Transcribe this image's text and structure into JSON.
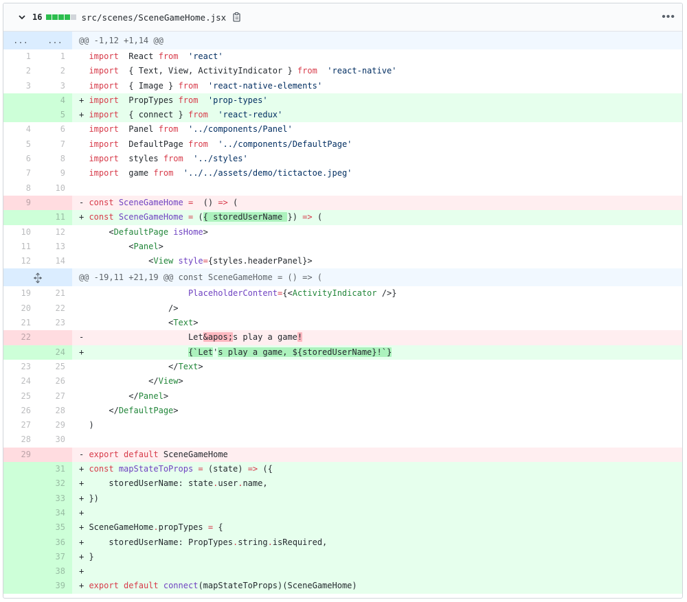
{
  "file": {
    "change_count": "16",
    "path": "src/scenes/SceneGameHome.jsx",
    "more_label": "•••",
    "diffstat_colors": [
      "#2cbe4e",
      "#2cbe4e",
      "#2cbe4e",
      "#2cbe4e",
      "#d1d5da"
    ]
  },
  "colors": {
    "add_line_bg": "#e6ffed",
    "add_num_bg": "#cdffd8",
    "del_line_bg": "#ffeef0",
    "del_num_bg": "#ffdce0",
    "hunk_bg": "#f1f8ff",
    "keyword": "#d73a49",
    "string": "#032f62",
    "function": "#6f42c1",
    "tag": "#22863a"
  },
  "hunks": [
    {
      "left": "...",
      "right": "...",
      "header": "@@ -1,12 +1,14 @@"
    },
    {
      "left_icon": "unfold-icon",
      "header": "@@ -19,11 +21,19 @@ const SceneGameHome = () => ("
    }
  ],
  "lines": [
    {
      "type": "ctx",
      "old": "1",
      "new": "1",
      "sign": " ",
      "tokens": [
        [
          "k",
          "import"
        ],
        [
          "",
          "  React "
        ],
        [
          "k",
          "from"
        ],
        [
          "",
          "  "
        ],
        [
          "s",
          "'react'"
        ]
      ]
    },
    {
      "type": "ctx",
      "old": "2",
      "new": "2",
      "sign": " ",
      "tokens": [
        [
          "k",
          "import"
        ],
        [
          "",
          "  { Text, View, ActivityIndicator } "
        ],
        [
          "k",
          "from"
        ],
        [
          "",
          "  "
        ],
        [
          "s",
          "'react-native'"
        ]
      ]
    },
    {
      "type": "ctx",
      "old": "3",
      "new": "3",
      "sign": " ",
      "tokens": [
        [
          "k",
          "import"
        ],
        [
          "",
          "  { Image } "
        ],
        [
          "k",
          "from"
        ],
        [
          "",
          "  "
        ],
        [
          "s",
          "'react-native-elements'"
        ]
      ]
    },
    {
      "type": "add",
      "old": "",
      "new": "4",
      "sign": "+",
      "tokens": [
        [
          "k",
          "import"
        ],
        [
          "",
          "  PropTypes "
        ],
        [
          "k",
          "from"
        ],
        [
          "",
          "  "
        ],
        [
          "s",
          "'prop-types'"
        ]
      ]
    },
    {
      "type": "add",
      "old": "",
      "new": "5",
      "sign": "+",
      "tokens": [
        [
          "k",
          "import"
        ],
        [
          "",
          "  { connect } "
        ],
        [
          "k",
          "from"
        ],
        [
          "",
          "  "
        ],
        [
          "s",
          "'react-redux'"
        ]
      ]
    },
    {
      "type": "ctx",
      "old": "4",
      "new": "6",
      "sign": " ",
      "tokens": [
        [
          "k",
          "import"
        ],
        [
          "",
          "  Panel "
        ],
        [
          "k",
          "from"
        ],
        [
          "",
          "  "
        ],
        [
          "s",
          "'../components/Panel'"
        ]
      ]
    },
    {
      "type": "ctx",
      "old": "5",
      "new": "7",
      "sign": " ",
      "tokens": [
        [
          "k",
          "import"
        ],
        [
          "",
          "  DefaultPage "
        ],
        [
          "k",
          "from"
        ],
        [
          "",
          "  "
        ],
        [
          "s",
          "'../components/DefaultPage'"
        ]
      ]
    },
    {
      "type": "ctx",
      "old": "6",
      "new": "8",
      "sign": " ",
      "tokens": [
        [
          "k",
          "import"
        ],
        [
          "",
          "  styles "
        ],
        [
          "k",
          "from"
        ],
        [
          "",
          "  "
        ],
        [
          "s",
          "'../styles'"
        ]
      ]
    },
    {
      "type": "ctx",
      "old": "7",
      "new": "9",
      "sign": " ",
      "tokens": [
        [
          "k",
          "import"
        ],
        [
          "",
          "  game "
        ],
        [
          "k",
          "from"
        ],
        [
          "",
          "  "
        ],
        [
          "s",
          "'../../assets/demo/tictactoe.jpeg'"
        ]
      ]
    },
    {
      "type": "ctx",
      "old": "8",
      "new": "10",
      "sign": " ",
      "tokens": []
    },
    {
      "type": "del",
      "old": "9",
      "new": "",
      "sign": "-",
      "tokens": [
        [
          "k",
          "const"
        ],
        [
          "",
          " "
        ],
        [
          "f",
          "SceneGameHome"
        ],
        [
          "",
          " "
        ],
        [
          "k",
          "="
        ],
        [
          "",
          "  () "
        ],
        [
          "k",
          "=>"
        ],
        [
          "",
          " ("
        ]
      ]
    },
    {
      "type": "add",
      "old": "",
      "new": "11",
      "sign": "+",
      "tokens": [
        [
          "k",
          "const"
        ],
        [
          "",
          " "
        ],
        [
          "f",
          "SceneGameHome"
        ],
        [
          "",
          " "
        ],
        [
          "k",
          "="
        ],
        [
          "",
          " ("
        ],
        [
          "hl-add",
          "{ storedUserName "
        ],
        [
          "",
          "}) "
        ],
        [
          "k",
          "=>"
        ],
        [
          "",
          " ("
        ]
      ]
    },
    {
      "type": "ctx",
      "old": "10",
      "new": "12",
      "sign": " ",
      "tokens": [
        [
          "",
          "    <"
        ],
        [
          "t",
          "DefaultPage"
        ],
        [
          "",
          " "
        ],
        [
          "f",
          "isHome"
        ],
        [
          "",
          ">"
        ]
      ]
    },
    {
      "type": "ctx",
      "old": "11",
      "new": "13",
      "sign": " ",
      "tokens": [
        [
          "",
          "        <"
        ],
        [
          "t",
          "Panel"
        ],
        [
          "",
          ">"
        ]
      ]
    },
    {
      "type": "ctx",
      "old": "12",
      "new": "14",
      "sign": " ",
      "tokens": [
        [
          "",
          "            <"
        ],
        [
          "t",
          "View"
        ],
        [
          "",
          " "
        ],
        [
          "f",
          "style"
        ],
        [
          "k",
          "="
        ],
        [
          "",
          "{styles.headerPanel}>"
        ]
      ]
    },
    {
      "type": "hunk",
      "index": 1
    },
    {
      "type": "ctx",
      "old": "19",
      "new": "21",
      "sign": " ",
      "tokens": [
        [
          "",
          "                    "
        ],
        [
          "f",
          "PlaceholderContent"
        ],
        [
          "k",
          "="
        ],
        [
          "",
          "{<"
        ],
        [
          "t",
          "ActivityIndicator"
        ],
        [
          "",
          " />}"
        ]
      ]
    },
    {
      "type": "ctx",
      "old": "20",
      "new": "22",
      "sign": " ",
      "tokens": [
        [
          "",
          "                />"
        ]
      ]
    },
    {
      "type": "ctx",
      "old": "21",
      "new": "23",
      "sign": " ",
      "tokens": [
        [
          "",
          "                <"
        ],
        [
          "t",
          "Text"
        ],
        [
          "",
          ">"
        ]
      ]
    },
    {
      "type": "del",
      "old": "22",
      "new": "",
      "sign": "-",
      "tokens": [
        [
          "",
          "                    Let"
        ],
        [
          "hl-del",
          "&apos;"
        ],
        [
          "",
          "s play a game"
        ],
        [
          "hl-del",
          "!"
        ]
      ]
    },
    {
      "type": "add",
      "old": "",
      "new": "24",
      "sign": "+",
      "tokens": [
        [
          "",
          "                    "
        ],
        [
          "hl-add",
          "{`Let"
        ],
        [
          "",
          "'"
        ],
        [
          "hl-add",
          "s play a game, ${storedUserName}!`}"
        ]
      ]
    },
    {
      "type": "ctx",
      "old": "23",
      "new": "25",
      "sign": " ",
      "tokens": [
        [
          "",
          "                </"
        ],
        [
          "t",
          "Text"
        ],
        [
          "",
          ">"
        ]
      ]
    },
    {
      "type": "ctx",
      "old": "24",
      "new": "26",
      "sign": " ",
      "tokens": [
        [
          "",
          "            </"
        ],
        [
          "t",
          "View"
        ],
        [
          "",
          ">"
        ]
      ]
    },
    {
      "type": "ctx",
      "old": "25",
      "new": "27",
      "sign": " ",
      "tokens": [
        [
          "",
          "        </"
        ],
        [
          "t",
          "Panel"
        ],
        [
          "",
          ">"
        ]
      ]
    },
    {
      "type": "ctx",
      "old": "26",
      "new": "28",
      "sign": " ",
      "tokens": [
        [
          "",
          "    </"
        ],
        [
          "t",
          "DefaultPage"
        ],
        [
          "",
          ">"
        ]
      ]
    },
    {
      "type": "ctx",
      "old": "27",
      "new": "29",
      "sign": " ",
      "tokens": [
        [
          "",
          ")"
        ]
      ]
    },
    {
      "type": "ctx",
      "old": "28",
      "new": "30",
      "sign": " ",
      "tokens": []
    },
    {
      "type": "del",
      "old": "29",
      "new": "",
      "sign": "-",
      "tokens": [
        [
          "k",
          "export"
        ],
        [
          "",
          " "
        ],
        [
          "k",
          "default"
        ],
        [
          "",
          " SceneGameHome"
        ]
      ]
    },
    {
      "type": "add",
      "old": "",
      "new": "31",
      "sign": "+",
      "tokens": [
        [
          "k",
          "const"
        ],
        [
          "",
          " "
        ],
        [
          "f",
          "mapStateToProps"
        ],
        [
          "",
          " "
        ],
        [
          "k",
          "="
        ],
        [
          "",
          " (state) "
        ],
        [
          "k",
          "=>"
        ],
        [
          "",
          " ({"
        ]
      ]
    },
    {
      "type": "add",
      "old": "",
      "new": "32",
      "sign": "+",
      "tokens": [
        [
          "",
          "    storedUserName: state"
        ],
        [
          "k",
          "."
        ],
        [
          "",
          "user"
        ],
        [
          "k",
          "."
        ],
        [
          "",
          "name,"
        ]
      ]
    },
    {
      "type": "add",
      "old": "",
      "new": "33",
      "sign": "+",
      "tokens": [
        [
          "",
          "})"
        ]
      ]
    },
    {
      "type": "add",
      "old": "",
      "new": "34",
      "sign": "+",
      "tokens": []
    },
    {
      "type": "add",
      "old": "",
      "new": "35",
      "sign": "+",
      "tokens": [
        [
          "",
          "SceneGameHome"
        ],
        [
          "k",
          "."
        ],
        [
          "",
          "propTypes "
        ],
        [
          "k",
          "="
        ],
        [
          "",
          " {"
        ]
      ]
    },
    {
      "type": "add",
      "old": "",
      "new": "36",
      "sign": "+",
      "tokens": [
        [
          "",
          "    storedUserName: PropTypes"
        ],
        [
          "k",
          "."
        ],
        [
          "",
          "string"
        ],
        [
          "k",
          "."
        ],
        [
          "",
          "isRequired,"
        ]
      ]
    },
    {
      "type": "add",
      "old": "",
      "new": "37",
      "sign": "+",
      "tokens": [
        [
          "",
          "}"
        ]
      ]
    },
    {
      "type": "add",
      "old": "",
      "new": "38",
      "sign": "+",
      "tokens": []
    },
    {
      "type": "add",
      "old": "",
      "new": "39",
      "sign": "+",
      "tokens": [
        [
          "k",
          "export"
        ],
        [
          "",
          " "
        ],
        [
          "k",
          "default"
        ],
        [
          "",
          " "
        ],
        [
          "f",
          "connect"
        ],
        [
          "",
          "(mapStateToProps)(SceneGameHome)"
        ]
      ]
    }
  ]
}
